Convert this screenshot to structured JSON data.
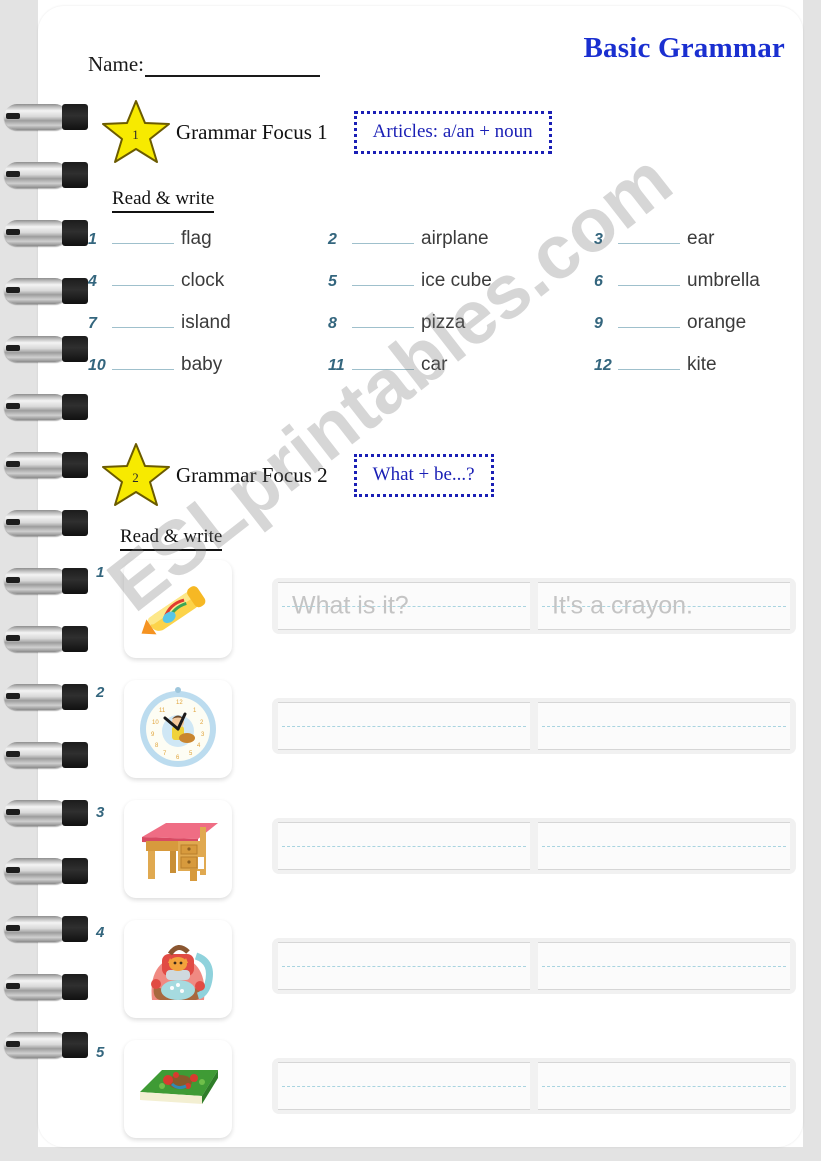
{
  "header": {
    "title": "Basic Grammar",
    "name_label": "Name:"
  },
  "section1": {
    "star_number": "1",
    "focus_label": "Grammar Focus 1",
    "focus_topic": "Articles: a/an + noun",
    "instruction": "Read & write",
    "items": [
      {
        "num": "1",
        "word": "flag"
      },
      {
        "num": "2",
        "word": "airplane"
      },
      {
        "num": "3",
        "word": "ear"
      },
      {
        "num": "4",
        "word": "clock"
      },
      {
        "num": "5",
        "word": "ice cube"
      },
      {
        "num": "6",
        "word": "umbrella"
      },
      {
        "num": "7",
        "word": "island"
      },
      {
        "num": "8",
        "word": "pizza"
      },
      {
        "num": "9",
        "word": "orange"
      },
      {
        "num": "10",
        "word": "baby"
      },
      {
        "num": "11",
        "word": "car"
      },
      {
        "num": "12",
        "word": "kite"
      }
    ]
  },
  "section2": {
    "star_number": "2",
    "focus_label": "Grammar Focus 2",
    "focus_topic": "What + be...?",
    "instruction": "Read & write",
    "rows": [
      {
        "num": "1",
        "image": "crayon-icon",
        "question": "What is it?",
        "answer": "It's a crayon."
      },
      {
        "num": "2",
        "image": "clock-icon",
        "question": "",
        "answer": ""
      },
      {
        "num": "3",
        "image": "desk-icon",
        "question": "",
        "answer": ""
      },
      {
        "num": "4",
        "image": "backpack-icon",
        "question": "",
        "answer": ""
      },
      {
        "num": "5",
        "image": "book-icon",
        "question": "",
        "answer": ""
      }
    ]
  },
  "watermark": {
    "text": "ESLprintables.com"
  },
  "colors": {
    "title_blue": "#1a2fd0",
    "focus_box_blue": "#1a1fb5",
    "number_teal": "#34667e",
    "blank_line": "#9fc0cc",
    "star_yellow": "#f7ea00",
    "trace_gray": "#c4c4c4",
    "dash_line": "#a9d4e0"
  }
}
